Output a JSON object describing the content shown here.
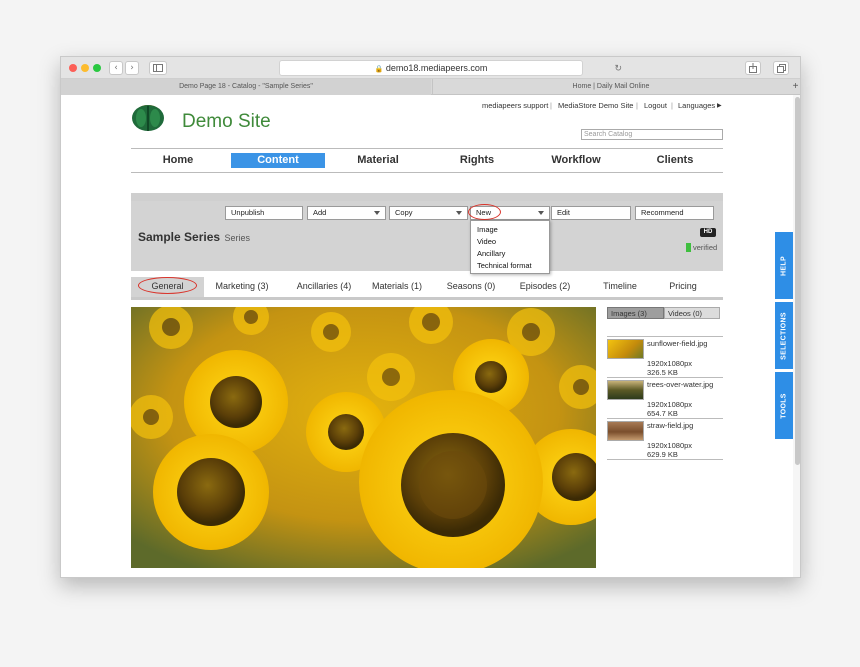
{
  "browser": {
    "address": "demo18.mediapeers.com",
    "tabs": [
      "Demo Page 18 - Catalog - \"Sample Series\"",
      "Home | Daily Mail Online"
    ]
  },
  "site": {
    "logo_text": "Demo Site",
    "brand_color": "#3f8a3a",
    "top_links": [
      "mediapeers support",
      "MediaStore Demo Site",
      "Logout",
      "Languages"
    ],
    "search_placeholder": "Search Catalog"
  },
  "nav": [
    "Home",
    "Content",
    "Material",
    "Rights",
    "Workflow",
    "Clients"
  ],
  "nav_active": "Content",
  "accent_color": "#3b94e6",
  "toolbar": {
    "unpublish": "Unpublish",
    "add": "Add",
    "copy": "Copy",
    "new": "New",
    "edit": "Edit",
    "recommend": "Recommend"
  },
  "new_menu": [
    "Image",
    "Video",
    "Ancillary",
    "Technical format"
  ],
  "title": {
    "name": "Sample Series",
    "type": "Series",
    "badge": "HD",
    "status": "verified",
    "status_color": "#3fbf3f"
  },
  "subtabs": [
    "General",
    "Marketing (3)",
    "Ancillaries (4)",
    "Materials (1)",
    "Seasons (0)",
    "Episodes (2)",
    "Timeline",
    "Pricing"
  ],
  "media_tabs": [
    "Images (3)",
    "Videos (0)"
  ],
  "media": [
    {
      "name": "sunflower-field.jpg",
      "dims": "1920x1080px",
      "size": "326.5 KB"
    },
    {
      "name": "trees-over-water.jpg",
      "dims": "1920x1080px",
      "size": "654.7 KB"
    },
    {
      "name": "straw-field.jpg",
      "dims": "1920x1080px",
      "size": "629.9 KB"
    }
  ],
  "side_tabs": [
    "HELP",
    "SELECTIONS",
    "TOOLS"
  ]
}
